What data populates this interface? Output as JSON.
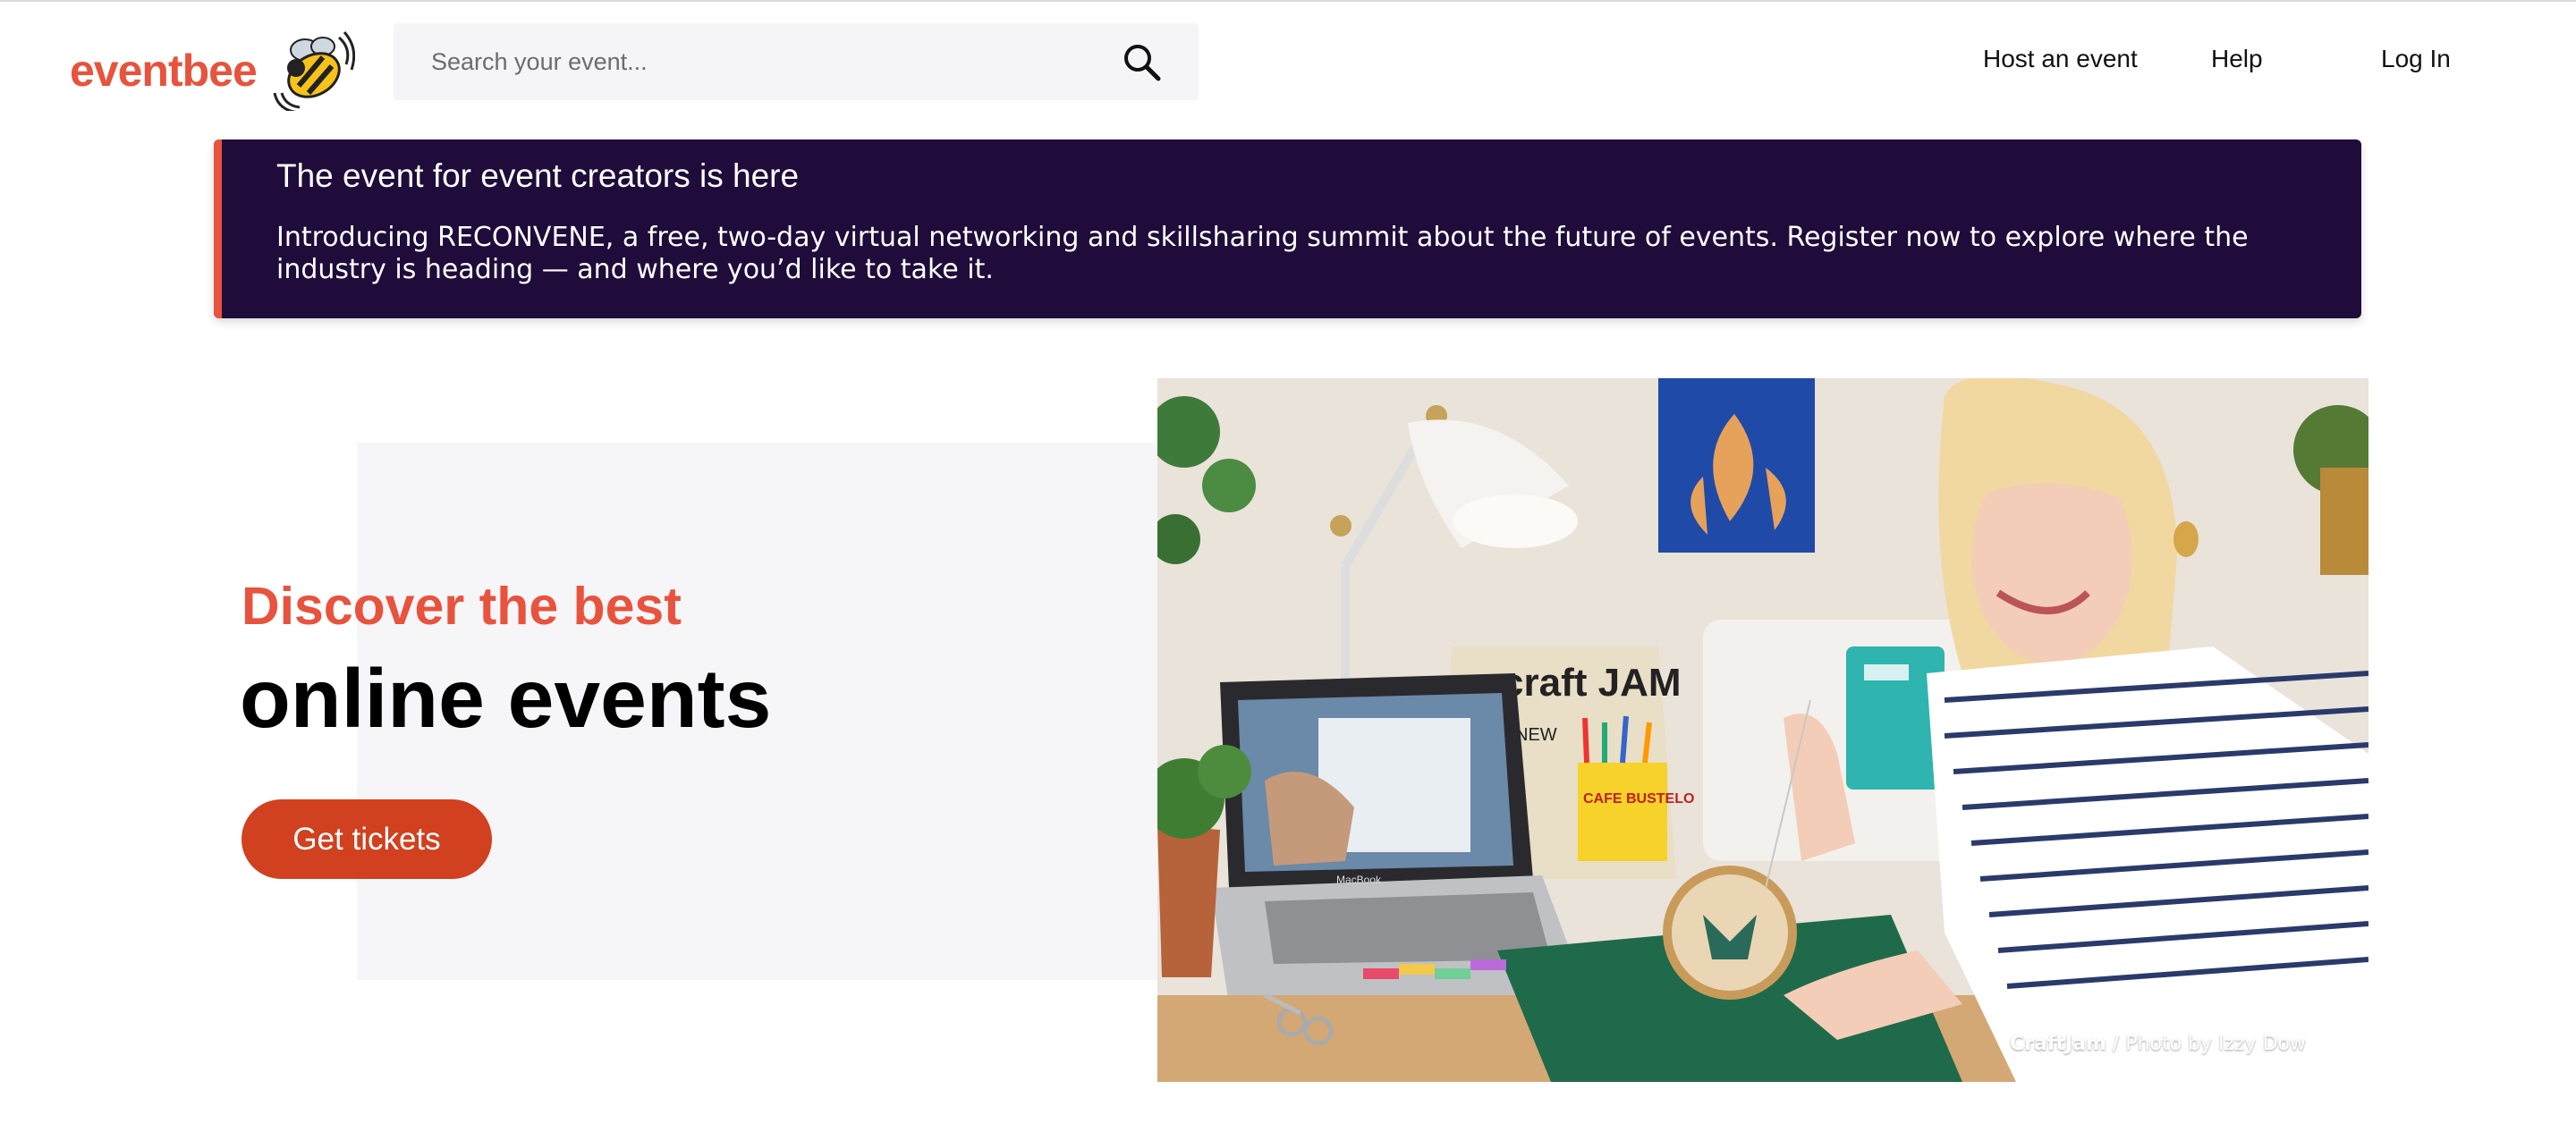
{
  "header": {
    "logo_text": "eventbee",
    "search_placeholder": "Search your event...",
    "nav": {
      "host": "Host an event",
      "help": "Help",
      "login": "Log In"
    }
  },
  "banner": {
    "title": "The event for event creators is here",
    "body": "Introducing RECONVENE, a free, two-day virtual networking and skillsharing summit about the future of events. Register now to explore where the industry is heading — and where you’d like to take it."
  },
  "hero": {
    "subtitle": "Discover the best",
    "title": "online events",
    "cta_label": "Get tickets"
  },
  "photo": {
    "credit_brand": "CraftJam",
    "credit_separator": " / ",
    "credit_text": "Photo by Izzy Dow",
    "props": {
      "bag_text": "craft JAM",
      "bag_sub": "NEW",
      "can_text": "CAFE BUSTELO",
      "laptop_label": "MacBook"
    }
  },
  "colors": {
    "brand": "#e8533d",
    "banner_bg": "#1f0c3a",
    "cta": "#d1401f",
    "hero_panel": "#f6f6f9"
  },
  "icons": {
    "search": "search-icon",
    "logo": "bee-icon"
  }
}
